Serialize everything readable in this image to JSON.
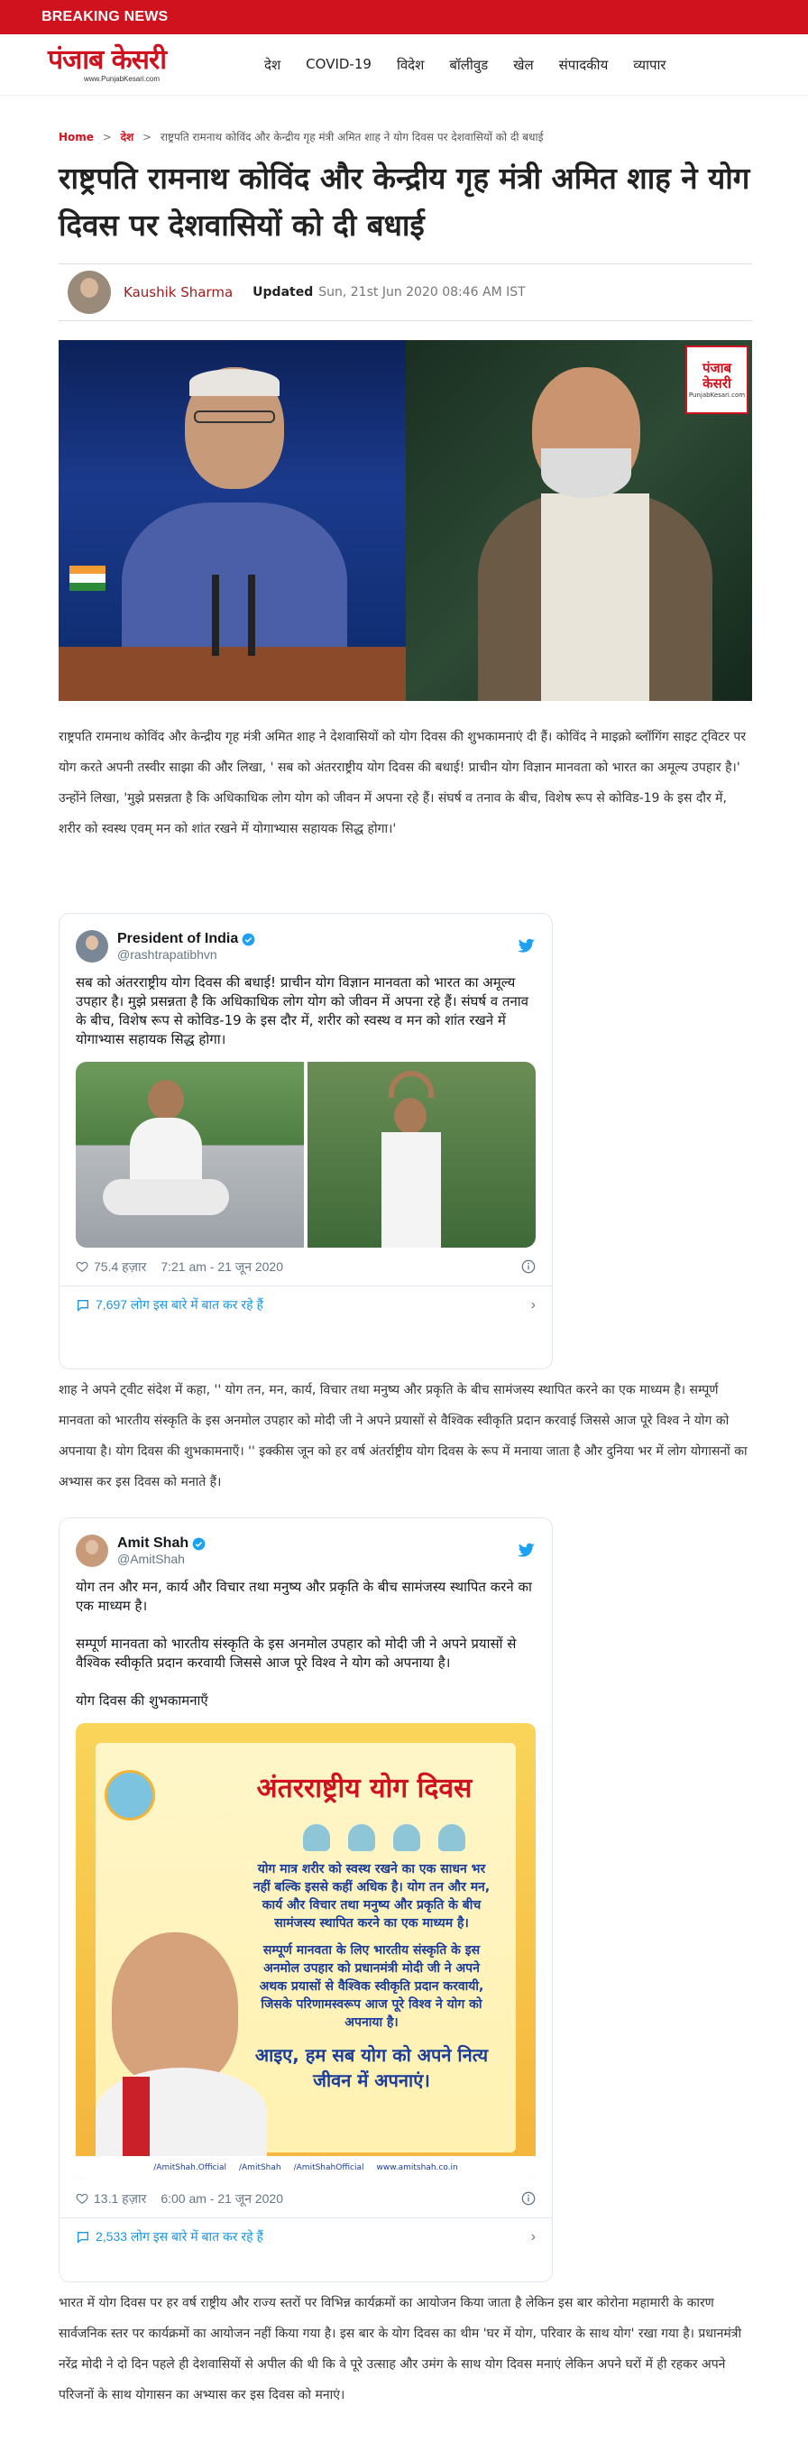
{
  "breaking_label": "BREAKING NEWS",
  "logo": {
    "main": "पंजाब केसरी",
    "sub": "www.PunjabKesari.com"
  },
  "nav": [
    "देश",
    "COVID-19",
    "विदेश",
    "बॉलीवुड",
    "खेल",
    "संपादकीय",
    "व्यापार"
  ],
  "breadcrumb": {
    "home": "Home",
    "section": "देश",
    "current": "राष्ट्रपति रामनाथ कोविंद और केन्द्रीय गृह मंत्री अमित शाह ने योग दिवस पर देशवासियों को दी बधाई"
  },
  "article": {
    "title": "राष्ट्रपति रामनाथ कोविंद और केन्द्रीय गृह मंत्री अमित शाह ने योग दिवस पर देशवासियों को दी बधाई",
    "author": "Kaushik Sharma",
    "updated_label": "Updated",
    "updated_time": "Sun, 21st Jun 2020 08:46 AM IST",
    "hero_logo": {
      "main": "पंजाब केसरी",
      "sub": "PunjabKesari.com"
    },
    "para1": "राष्ट्रपति रामनाथ कोविंद और केन्द्रीय गृह मंत्री अमित शाह ने देशवासियों को योग दिवस की शुभकामनाएं दी हैं। कोविंद ने माइक्रो ब्लॉगिंग साइट ट्विटर पर योग करते अपनी तस्वीर साझा की और लिखा, ' सब को अंतरराष्ट्रीय योग दिवस की बधाई! प्राचीन योग विज्ञान मानवता को भारत का अमूल्य उपहार है।' उन्होंने लिखा, 'मुझे प्रसन्नता है कि अधिकाधिक लोग योग को जीवन में अपना रहे हैं। संघर्ष व तनाव के बीच, विशेष रूप से कोविड-19 के इस दौर में, शरीर को स्वस्थ एवम् मन को शांत रखने में योगाभ्यास सहायक सिद्ध होगा।'",
    "para2": "शाह ने अपने ट्वीट संदेश में कहा, '' योग तन, मन, कार्य, विचार तथा मनुष्य और प्रकृति के बीच सामंजस्य स्थापित करने का एक माध्यम है। सम्पूर्ण मानवता को भारतीय संस्कृति के इस अनमोल उपहार को मोदी जी ने अपने प्रयासों से वैश्विक स्वीकृति प्रदान करवाई जिससे आज पूरे विश्व ने योग को अपनाया है। योग दिवस की शुभकामनाएँ। '' इक्कीस जून को हर वर्ष अंतर्राष्ट्रीय योग दिवस के रूप में मनाया जाता है और दुनिया भर में लोग योगासनों का अभ्यास कर इस दिवस को मनाते हैं।",
    "para3": "भारत में योग दिवस पर हर वर्ष राष्ट्रीय और राज्य स्तरों पर विभिन्न कार्यक्रमों का आयोजन किया जाता है लेकिन इस बार कोरोना महामारी के कारण सार्वजनिक स्तर पर कार्यक्रमों का आयोजन नहीं किया गया है। इस बार के योग दिवस का थीम 'घर में योग, परिवार के साथ योग' रखा गया है। प्रधानमंत्री नरेंद्र मोदी ने दो दिन पहले ही देशवासियों से अपील की थी कि वे पूरे उत्साह और उमंग के साथ योग दिवस मनाएं लेकिन अपने घरों में ही रहकर अपने परिजनों के साथ योगासन का अभ्यास कर इस दिवस को मनाएं।"
  },
  "tweet1": {
    "name": "President of India",
    "handle": "@rashtrapatibhvn",
    "text": "सब को अंतरराष्ट्रीय योग दिवस की बधाई! प्राचीन योग विज्ञान मानवता को भारत का अमूल्य उपहार है। मुझे प्रसन्नता है कि अधिकाधिक लोग योग को जीवन में अपना रहे हैं। संघर्ष व तनाव के बीच, विशेष रूप से कोविड-19 के इस दौर में, शरीर को स्वस्थ व मन को शांत रखने में योगाभ्यास सहायक सिद्ध होगा।",
    "likes": "75.4 हज़ार",
    "time": "7:21 am - 21 जून 2020",
    "footer": "7,697 लोग इस बारे में बात कर रहे हैं"
  },
  "tweet2": {
    "name": "Amit Shah",
    "handle": "@AmitShah",
    "text": "योग तन और मन, कार्य और विचार तथा मनुष्य और प्रकृति के बीच सामंजस्य स्थापित करने का एक माध्यम है।\n\nसम्पूर्ण मानवता को भारतीय संस्कृति के इस अनमोल उपहार को मोदी जी ने अपने प्रयासों से वैश्विक स्वीकृति प्रदान करवायी जिससे आज पूरे विश्व ने योग को अपनाया है।\n\nयोग दिवस की शुभकामनाएँ",
    "poster": {
      "title": "अंतरराष्ट्रीय योग दिवस",
      "body1": "योग मात्र शरीर को स्वस्थ रखने का एक साधन भर नहीं बल्कि इससे कहीं अधिक है। योग तन और मन, कार्य और विचार तथा मनुष्य और प्रकृति के बीच सामंजस्य स्थापित करने का एक माध्यम है।",
      "body2": "सम्पूर्ण मानवता के लिए भारतीय संस्कृति के इस अनमोल उपहार को प्रधानमंत्री मोदी जी ने अपने अथक प्रयासों से वैश्विक स्वीकृति प्रदान करवायी, जिसके परिणामस्वरूप आज पूरे विश्व ने योग को अपनाया है।",
      "body3": "आइए, हम सब योग को अपने नित्य जीवन में अपनाएं।",
      "footer": [
        "/AmitShah.Official",
        "/AmitShah",
        "/AmitShahOfficial",
        "www.amitshah.co.in"
      ]
    },
    "likes": "13.1 हज़ार",
    "time": "6:00 am - 21 जून 2020",
    "footer": "2,533 लोग इस बारे में बात कर रहे हैं"
  },
  "colors": {
    "brand_red": "#d0121f",
    "twitter_blue": "#1b95e0"
  }
}
